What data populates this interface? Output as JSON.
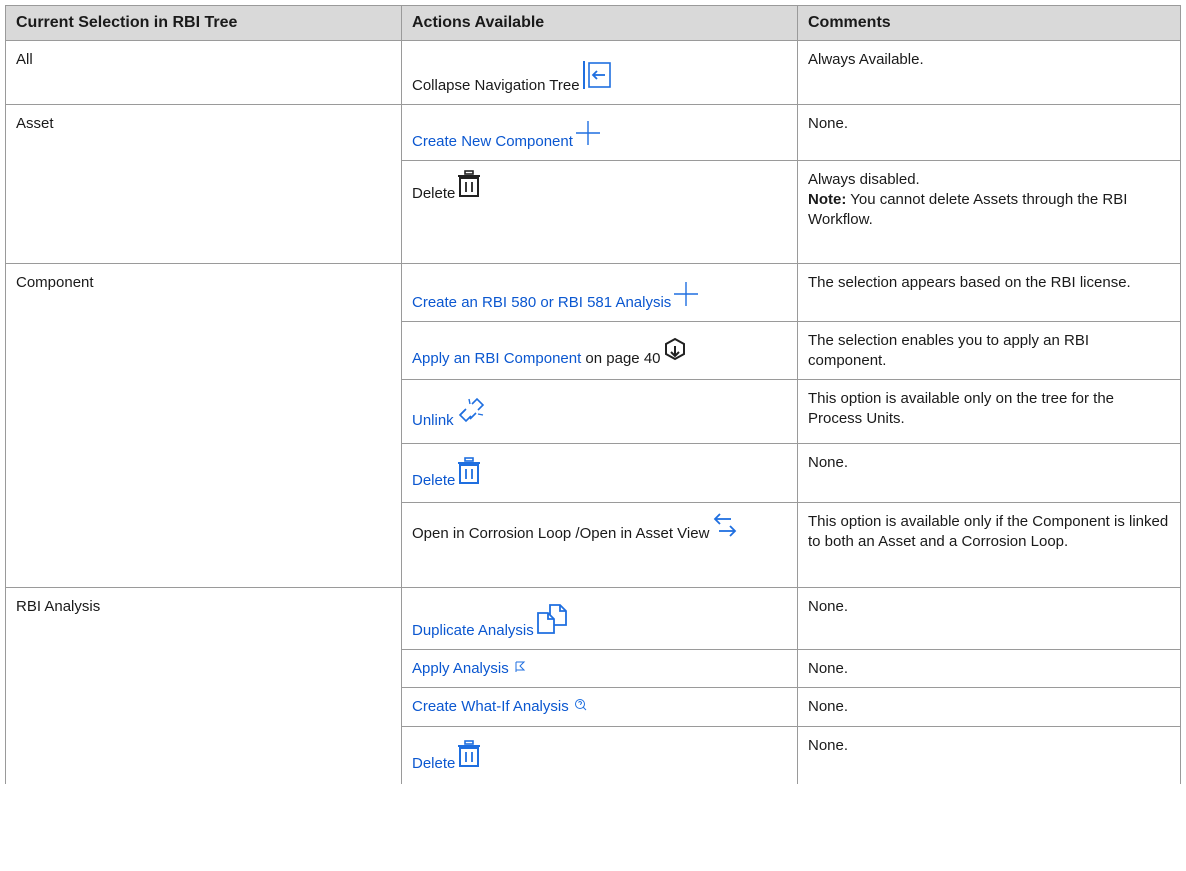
{
  "headers": [
    "Current Selection in RBI Tree",
    "Actions Available",
    "Comments"
  ],
  "rows": {
    "all": {
      "selection": "All",
      "action": "Collapse Navigation Tree",
      "icon": "collapse-tree-icon",
      "comment": "Always Available."
    },
    "asset": {
      "selection": "Asset",
      "actions": [
        {
          "label": "Create New Component",
          "icon": "plus-icon",
          "comment": "None."
        },
        {
          "label": "Delete",
          "icon": "trash-icon",
          "comment": "Always disabled.",
          "note_label": "Note:",
          "note_text": " You cannot delete Assets through the RBI Workflow."
        }
      ]
    },
    "component": {
      "selection": "Component",
      "actions": [
        {
          "label": "Create an RBI 580 or RBI 581 Analysis",
          "icon": "plus-icon",
          "comment": "The selection appears based on the RBI license."
        },
        {
          "label": "Apply an RBI Component",
          "suffix": " on page 40",
          "icon": "apply-component-icon",
          "comment": "The selection enables you to apply an RBI component."
        },
        {
          "label": "Unlink",
          "icon": "unlink-icon",
          "comment": "This option is available only on the tree for the Process Units."
        },
        {
          "label": "Delete",
          "icon": "trash-icon",
          "comment": "None."
        },
        {
          "label": "Open in Corrosion Loop /Open in Asset View",
          "icon": "swap-arrows-icon",
          "comment": "This option is available only if the Component is linked to both an Asset and a Corrosion Loop."
        }
      ]
    },
    "rbi_analysis": {
      "selection": "RBI Analysis",
      "actions": [
        {
          "label": "Duplicate Analysis",
          "icon": "duplicate-icon",
          "comment": "None."
        },
        {
          "label": "Apply Analysis",
          "icon": "apply-analysis-icon",
          "comment": "None."
        },
        {
          "label": "Create What-If Analysis",
          "icon": "what-if-icon",
          "comment": "None."
        },
        {
          "label": "Delete",
          "icon": "trash-icon",
          "comment": "None."
        }
      ]
    }
  },
  "colors": {
    "link": "#0b57d0",
    "header_bg": "#d9d9d9",
    "border": "#9a9a9a"
  }
}
